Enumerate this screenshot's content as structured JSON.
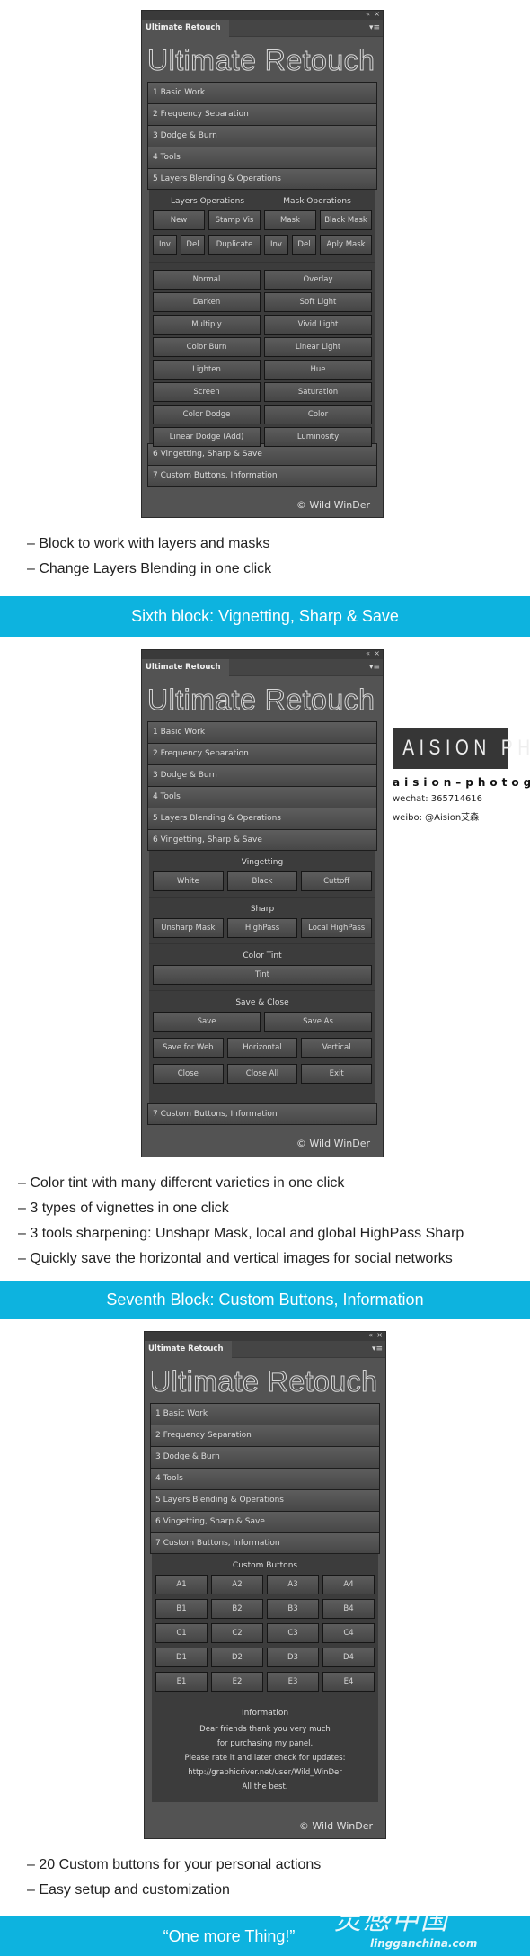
{
  "common": {
    "tab_label": "Ultimate Retouch",
    "title": "Ultimate Retouch",
    "copyright": "© Wild WinDer",
    "icons": {
      "collapse": "«",
      "close": "×",
      "menu": "▾≡"
    },
    "sections": [
      "1 Basic Work",
      "2 Frequency Separation",
      "3 Dodge & Burn",
      "4 Tools",
      "5 Layers Blending & Operations",
      "6 Vingetting, Sharp & Save",
      "7 Custom Buttons, Information"
    ]
  },
  "panel1": {
    "layers_ops_label": "Layers Operations",
    "mask_ops_label": "Mask Operations",
    "row1": [
      "New",
      "Stamp Vis",
      "Mask",
      "Black Mask"
    ],
    "row2": [
      "Inv",
      "Del",
      "Duplicate",
      "Inv",
      "Del",
      "Aply Mask"
    ],
    "blend_modes": [
      "Normal",
      "Overlay",
      "Darken",
      "Soft Light",
      "Multiply",
      "Vivid Light",
      "Color Burn",
      "Linear Light",
      "Lighten",
      "Hue",
      "Screen",
      "Saturation",
      "Color Dodge",
      "Color",
      "Linear Dodge (Add)",
      "Luminosity"
    ]
  },
  "bullets1": [
    "– Block to work with layers and masks",
    "– Change Layers Blending in one click"
  ],
  "band1": "Sixth block: Vignetting, Sharp & Save",
  "panel2": {
    "vignetting_label": "Vingetting",
    "vignetting": [
      "White",
      "Black",
      "Cuttoff"
    ],
    "sharp_label": "Sharp",
    "sharp": [
      "Unsharp Mask",
      "HighPass",
      "Local HighPass"
    ],
    "tint_label": "Color Tint",
    "tint": "Tint",
    "save_label": "Save & Close",
    "save_row": [
      "Save",
      "Save As"
    ],
    "save_row2": [
      "Save for Web",
      "Horizontal",
      "Vertical"
    ],
    "close_row": [
      "Close",
      "Close All",
      "Exit"
    ]
  },
  "watermark": {
    "banner": "AISION PHO",
    "name": "aision–photogr",
    "wechat": "wechat: 365714616",
    "weibo": "weibo: @Aision艾森"
  },
  "bullets2": [
    "– Color tint with many different varieties in one click",
    "– 3 types of vignettes in one click",
    "– 3 tools sharpening: Unshapr Mask, local and global HighPass Sharp",
    "– Quickly save the horizontal and vertical images for social networks"
  ],
  "band2": "Seventh Block: Custom Buttons, Information",
  "panel3": {
    "custom_label": "Custom Buttons",
    "custom_buttons": [
      "A1",
      "A2",
      "A3",
      "A4",
      "B1",
      "B2",
      "B3",
      "B4",
      "C1",
      "C2",
      "C3",
      "C4",
      "D1",
      "D2",
      "D3",
      "D4",
      "E1",
      "E2",
      "E3",
      "E4"
    ],
    "info_label": "Information",
    "info_lines": [
      "Dear friends thank you very much",
      "for purchasing my panel.",
      "Please rate it and later check for updates:",
      "http://graphicriver.net/user/Wild_WinDer",
      "All the best."
    ]
  },
  "bullets3": [
    "– 20 Custom buttons for your personal actions",
    "– Easy setup and customization"
  ],
  "band3": "“One more Thing!”",
  "site_logo": {
    "mark": "灵感中国",
    "url": "lingganchina.com"
  },
  "colors": {
    "accent": "#0db3df",
    "panel": "#535353",
    "button": "#4e4e4e"
  }
}
